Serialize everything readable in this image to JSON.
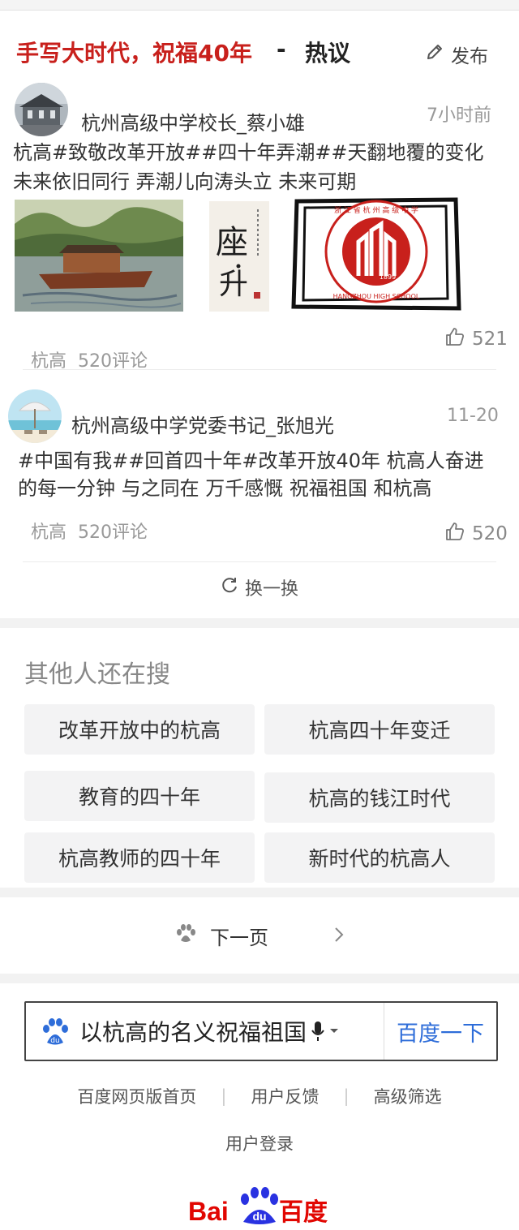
{
  "header": {
    "title": "手写大时代，祝福40年",
    "dash": "-",
    "hot": "热议",
    "publish_label": "发布"
  },
  "posts": [
    {
      "author": "杭州高级中学校长_蔡小雄",
      "time": "7小时前",
      "lines": [
        "杭高#致敬改革开放##四十年弄潮##天翻地覆的变化",
        "未来依旧同行  弄潮儿向涛头立  未来可期"
      ],
      "source": "杭高",
      "comments": "520评论",
      "likes": "521",
      "images": {
        "calligraphy_text": "座。升",
        "seal_top": "浙江省杭州高级中学",
        "seal_bottom": "HANGZHOU HIGH SCHOOL",
        "seal_year": "1899"
      }
    },
    {
      "author": "杭州高级中学党委书记_张旭光",
      "time": "11-20",
      "lines": [
        "#中国有我##回首四十年#改革开放40年  杭高人奋进",
        "的每一分钟  与之同在  万千感慨  祝福祖国  和杭高"
      ],
      "source": "杭高",
      "comments": "520评论",
      "likes": "520"
    }
  ],
  "refresh_label": "换一换",
  "others": {
    "title": "其他人还在搜",
    "items": [
      "改革开放中的杭高",
      "杭高四十年变迁",
      "教育的四十年",
      "杭高的钱江时代",
      "杭高教师的四十年",
      "新时代的杭高人"
    ]
  },
  "next_page_label": "下一页",
  "search": {
    "query": "以杭高的名义祝福祖国",
    "button": "百度一下"
  },
  "footer": {
    "links": [
      "百度网页版首页",
      "用户反馈",
      "高级筛选"
    ],
    "login": "用户登录"
  },
  "logo": {
    "text_bai": "Bai",
    "text_du": "du",
    "text_cn": "百度"
  },
  "colors": {
    "accent_red": "#c8201c",
    "link_blue": "#2e6dd9",
    "baidu_red": "#e10601",
    "baidu_blue": "#2932e1"
  },
  "icons": [
    "pencil-icon",
    "thumb-up-icon",
    "refresh-icon",
    "paw-icon",
    "chevron-right-icon",
    "microphone-icon",
    "dropdown-icon"
  ]
}
